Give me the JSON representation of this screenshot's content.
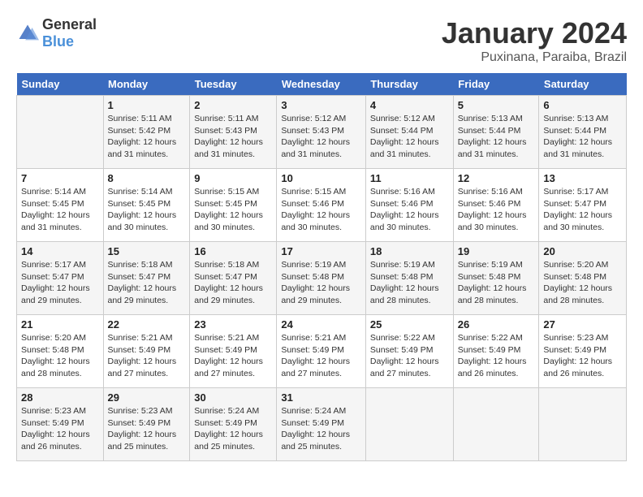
{
  "header": {
    "logo_general": "General",
    "logo_blue": "Blue",
    "month": "January 2024",
    "location": "Puxinana, Paraiba, Brazil"
  },
  "days_of_week": [
    "Sunday",
    "Monday",
    "Tuesday",
    "Wednesday",
    "Thursday",
    "Friday",
    "Saturday"
  ],
  "weeks": [
    [
      {
        "num": "",
        "info": ""
      },
      {
        "num": "1",
        "info": "Sunrise: 5:11 AM\nSunset: 5:42 PM\nDaylight: 12 hours\nand 31 minutes."
      },
      {
        "num": "2",
        "info": "Sunrise: 5:11 AM\nSunset: 5:43 PM\nDaylight: 12 hours\nand 31 minutes."
      },
      {
        "num": "3",
        "info": "Sunrise: 5:12 AM\nSunset: 5:43 PM\nDaylight: 12 hours\nand 31 minutes."
      },
      {
        "num": "4",
        "info": "Sunrise: 5:12 AM\nSunset: 5:44 PM\nDaylight: 12 hours\nand 31 minutes."
      },
      {
        "num": "5",
        "info": "Sunrise: 5:13 AM\nSunset: 5:44 PM\nDaylight: 12 hours\nand 31 minutes."
      },
      {
        "num": "6",
        "info": "Sunrise: 5:13 AM\nSunset: 5:44 PM\nDaylight: 12 hours\nand 31 minutes."
      }
    ],
    [
      {
        "num": "7",
        "info": "Sunrise: 5:14 AM\nSunset: 5:45 PM\nDaylight: 12 hours\nand 31 minutes."
      },
      {
        "num": "8",
        "info": "Sunrise: 5:14 AM\nSunset: 5:45 PM\nDaylight: 12 hours\nand 30 minutes."
      },
      {
        "num": "9",
        "info": "Sunrise: 5:15 AM\nSunset: 5:45 PM\nDaylight: 12 hours\nand 30 minutes."
      },
      {
        "num": "10",
        "info": "Sunrise: 5:15 AM\nSunset: 5:46 PM\nDaylight: 12 hours\nand 30 minutes."
      },
      {
        "num": "11",
        "info": "Sunrise: 5:16 AM\nSunset: 5:46 PM\nDaylight: 12 hours\nand 30 minutes."
      },
      {
        "num": "12",
        "info": "Sunrise: 5:16 AM\nSunset: 5:46 PM\nDaylight: 12 hours\nand 30 minutes."
      },
      {
        "num": "13",
        "info": "Sunrise: 5:17 AM\nSunset: 5:47 PM\nDaylight: 12 hours\nand 30 minutes."
      }
    ],
    [
      {
        "num": "14",
        "info": "Sunrise: 5:17 AM\nSunset: 5:47 PM\nDaylight: 12 hours\nand 29 minutes."
      },
      {
        "num": "15",
        "info": "Sunrise: 5:18 AM\nSunset: 5:47 PM\nDaylight: 12 hours\nand 29 minutes."
      },
      {
        "num": "16",
        "info": "Sunrise: 5:18 AM\nSunset: 5:47 PM\nDaylight: 12 hours\nand 29 minutes."
      },
      {
        "num": "17",
        "info": "Sunrise: 5:19 AM\nSunset: 5:48 PM\nDaylight: 12 hours\nand 29 minutes."
      },
      {
        "num": "18",
        "info": "Sunrise: 5:19 AM\nSunset: 5:48 PM\nDaylight: 12 hours\nand 28 minutes."
      },
      {
        "num": "19",
        "info": "Sunrise: 5:19 AM\nSunset: 5:48 PM\nDaylight: 12 hours\nand 28 minutes."
      },
      {
        "num": "20",
        "info": "Sunrise: 5:20 AM\nSunset: 5:48 PM\nDaylight: 12 hours\nand 28 minutes."
      }
    ],
    [
      {
        "num": "21",
        "info": "Sunrise: 5:20 AM\nSunset: 5:48 PM\nDaylight: 12 hours\nand 28 minutes."
      },
      {
        "num": "22",
        "info": "Sunrise: 5:21 AM\nSunset: 5:49 PM\nDaylight: 12 hours\nand 27 minutes."
      },
      {
        "num": "23",
        "info": "Sunrise: 5:21 AM\nSunset: 5:49 PM\nDaylight: 12 hours\nand 27 minutes."
      },
      {
        "num": "24",
        "info": "Sunrise: 5:21 AM\nSunset: 5:49 PM\nDaylight: 12 hours\nand 27 minutes."
      },
      {
        "num": "25",
        "info": "Sunrise: 5:22 AM\nSunset: 5:49 PM\nDaylight: 12 hours\nand 27 minutes."
      },
      {
        "num": "26",
        "info": "Sunrise: 5:22 AM\nSunset: 5:49 PM\nDaylight: 12 hours\nand 26 minutes."
      },
      {
        "num": "27",
        "info": "Sunrise: 5:23 AM\nSunset: 5:49 PM\nDaylight: 12 hours\nand 26 minutes."
      }
    ],
    [
      {
        "num": "28",
        "info": "Sunrise: 5:23 AM\nSunset: 5:49 PM\nDaylight: 12 hours\nand 26 minutes."
      },
      {
        "num": "29",
        "info": "Sunrise: 5:23 AM\nSunset: 5:49 PM\nDaylight: 12 hours\nand 25 minutes."
      },
      {
        "num": "30",
        "info": "Sunrise: 5:24 AM\nSunset: 5:49 PM\nDaylight: 12 hours\nand 25 minutes."
      },
      {
        "num": "31",
        "info": "Sunrise: 5:24 AM\nSunset: 5:49 PM\nDaylight: 12 hours\nand 25 minutes."
      },
      {
        "num": "",
        "info": ""
      },
      {
        "num": "",
        "info": ""
      },
      {
        "num": "",
        "info": ""
      }
    ]
  ]
}
